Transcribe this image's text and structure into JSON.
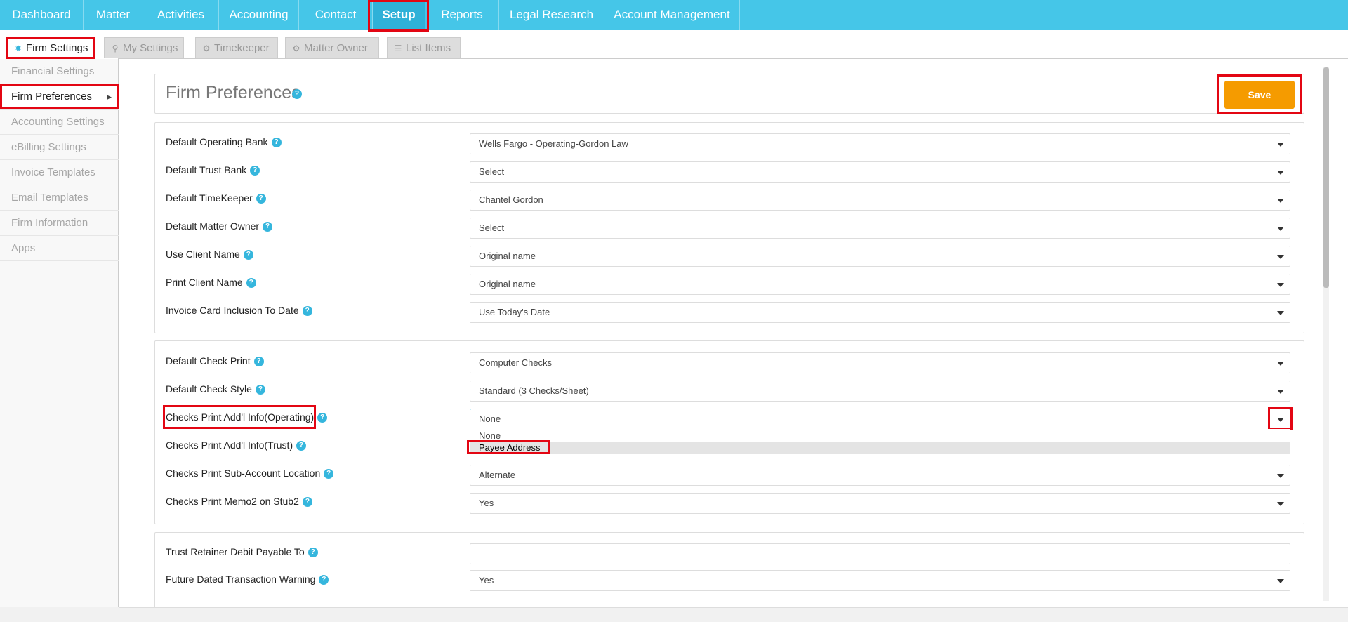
{
  "topnav": {
    "items": [
      "Dashboard",
      "Matter",
      "Activities",
      "Accounting",
      "Contact",
      "Setup",
      "Reports",
      "Legal Research",
      "Account Management"
    ],
    "active": "Setup"
  },
  "subtabs": {
    "items": [
      "Firm Settings",
      "My Settings",
      "Timekeeper",
      "Matter Owner",
      "List Items"
    ],
    "icons": [
      "gear-icon",
      "pin-icon",
      "gears-icon",
      "gear-icon",
      "list-icon"
    ],
    "active": "Firm Settings"
  },
  "sidebar": {
    "items": [
      "Financial Settings",
      "Firm Preferences",
      "Accounting Settings",
      "eBilling Settings",
      "Invoice Templates",
      "Email Templates",
      "Firm Information",
      "Apps"
    ],
    "active": "Firm Preferences"
  },
  "page": {
    "title": "Firm Preferences",
    "save_label": "Save"
  },
  "section1": [
    {
      "label": "Default Operating Bank",
      "value": "Wells Fargo - Operating-Gordon Law"
    },
    {
      "label": "Default Trust Bank",
      "value": "Select"
    },
    {
      "label": "Default TimeKeeper",
      "value": "Chantel Gordon"
    },
    {
      "label": "Default Matter Owner",
      "value": "Select"
    },
    {
      "label": "Use Client Name",
      "value": "Original name"
    },
    {
      "label": "Print Client Name",
      "value": "Original name"
    },
    {
      "label": "Invoice Card Inclusion To Date",
      "value": "Use Today's Date"
    }
  ],
  "section2": [
    {
      "label": "Default Check Print",
      "value": "Computer Checks"
    },
    {
      "label": "Default Check Style",
      "value": "Standard (3 Checks/Sheet)"
    },
    {
      "label": "Checks Print Add'l Info(Operating)",
      "value": "None"
    },
    {
      "label": "Checks Print Add'l Info(Trust)",
      "value": ""
    },
    {
      "label": "Checks Print Sub-Account Location",
      "value": "Alternate"
    },
    {
      "label": "Checks Print Memo2 on Stub2",
      "value": "Yes"
    }
  ],
  "dropdown_options": [
    "None",
    "Payee Address"
  ],
  "section3": [
    {
      "label": "Trust Retainer Debit Payable To",
      "value": ""
    },
    {
      "label": "Future Dated Transaction Warning",
      "value": "Yes"
    }
  ],
  "colors": {
    "nav_bg": "#45c6e8",
    "accent": "#35b6dd",
    "save": "#f59b00",
    "highlight": "#e30613"
  }
}
